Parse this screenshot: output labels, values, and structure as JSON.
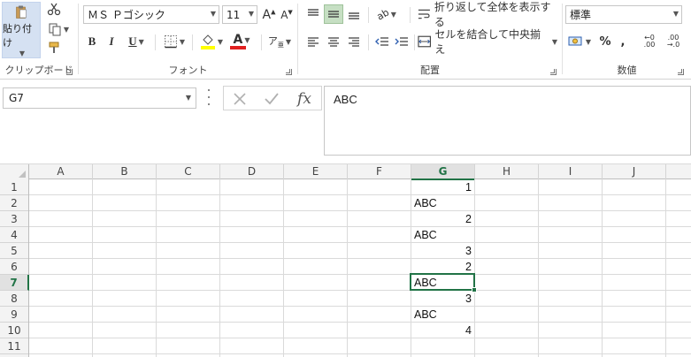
{
  "ribbon": {
    "clipboard": {
      "paste_label": "貼り付け",
      "group_label": "クリップボード"
    },
    "font": {
      "font_name": "ＭＳ Ｐゴシック",
      "font_size": "11",
      "bold": "B",
      "italic": "I",
      "underline": "U",
      "group_label": "フォント",
      "font_color": "#e02020",
      "fill_color": "#ffff00"
    },
    "alignment": {
      "wrap_text": "折り返して全体を表示する",
      "merge_center": "セルを結合して中央揃え",
      "group_label": "配置"
    },
    "number": {
      "format": "標準",
      "percent": "%",
      "comma": ",",
      "increase_decimal_top": "←0",
      "increase_decimal_bottom": ".00",
      "decrease_decimal_top": ".00",
      "decrease_decimal_bottom": "→.0",
      "group_label": "数値"
    }
  },
  "formula_bar": {
    "name_box": "G7",
    "content": "ABC"
  },
  "grid": {
    "columns": [
      "A",
      "B",
      "C",
      "D",
      "E",
      "F",
      "G",
      "H",
      "I",
      "J"
    ],
    "rows": [
      "1",
      "2",
      "3",
      "4",
      "5",
      "6",
      "7",
      "8",
      "9",
      "10",
      "11"
    ],
    "selected_column": "G",
    "selected_row": "7",
    "column_g_values": [
      {
        "row": 1,
        "value": "1",
        "kind": "num"
      },
      {
        "row": 2,
        "value": "ABC",
        "kind": "text"
      },
      {
        "row": 3,
        "value": "2",
        "kind": "num"
      },
      {
        "row": 4,
        "value": "ABC",
        "kind": "text"
      },
      {
        "row": 5,
        "value": "3",
        "kind": "num"
      },
      {
        "row": 6,
        "value": "2",
        "kind": "num"
      },
      {
        "row": 7,
        "value": "ABC",
        "kind": "text"
      },
      {
        "row": 8,
        "value": "3",
        "kind": "num"
      },
      {
        "row": 9,
        "value": "ABC",
        "kind": "text"
      },
      {
        "row": 10,
        "value": "4",
        "kind": "num"
      }
    ]
  },
  "colors": {
    "accent": "#217346",
    "selection_header": "#e1e1e1"
  }
}
